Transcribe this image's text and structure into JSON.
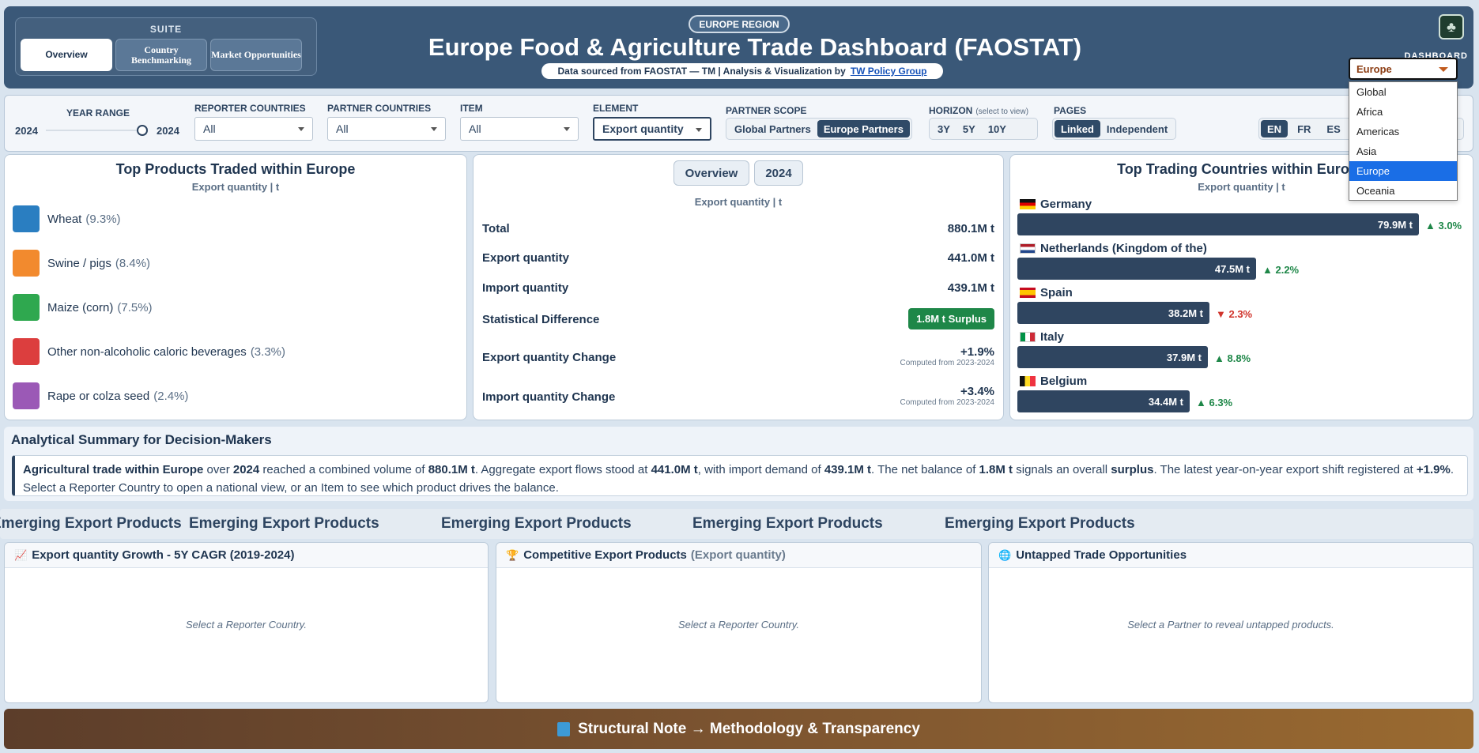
{
  "header": {
    "suite_title": "SUITE",
    "suite_tabs": [
      {
        "label": "Overview",
        "active": true
      },
      {
        "label": "Country Benchmarking",
        "active": false
      },
      {
        "label": "Market Opportunities",
        "active": false
      }
    ],
    "region_badge": "EUROPE REGION",
    "title": "Europe Food & Agriculture Trade Dashboard (FAOSTAT)",
    "subtitle_text": "Data sourced from FAOSTAT — TM | Analysis & Visualization by",
    "subtitle_link": "TW Policy Group",
    "dashboard_label": "DASHBOARD",
    "dashboard_value": "Europe",
    "dashboard_options": [
      "Global",
      "Africa",
      "Americas",
      "Asia",
      "Europe",
      "Oceania"
    ],
    "dashboard_selected_index": 4,
    "logo_icon": "leaf-logo-icon"
  },
  "filters": {
    "year_range_label": "YEAR RANGE",
    "year_start": "2024",
    "year_end": "2024",
    "reporter_label": "REPORTER COUNTRIES",
    "reporter_value": "All",
    "partner_label": "PARTNER COUNTRIES",
    "partner_value": "All",
    "item_label": "ITEM",
    "item_value": "All",
    "element_label": "ELEMENT",
    "element_value": "Export quantity",
    "scope_label": "PARTNER SCOPE",
    "scope_options": [
      "Global Partners",
      "Europe Partners"
    ],
    "scope_selected": "Europe Partners",
    "horizon_label": "HORIZON",
    "horizon_hint": "(select to view)",
    "horizon_options": [
      "3Y",
      "5Y",
      "10Y"
    ],
    "pages_label": "PAGES",
    "pages_options": [
      "Linked",
      "Independent"
    ],
    "pages_selected": "Linked",
    "languages": [
      "EN",
      "FR",
      "ES"
    ],
    "language_selected": "EN"
  },
  "top_products": {
    "title": "Top Products Traded within Europe",
    "subtitle": "Export quantity | t",
    "items": [
      {
        "name": "Wheat",
        "pct": "(9.3%)",
        "color": "#2a7ec1"
      },
      {
        "name": "Swine / pigs",
        "pct": "(8.4%)",
        "color": "#f28a2e"
      },
      {
        "name": "Maize (corn)",
        "pct": "(7.5%)",
        "color": "#2fa84f"
      },
      {
        "name": "Other non-alcoholic caloric beverages",
        "pct": "(3.3%)",
        "color": "#dc3e3e"
      },
      {
        "name": "Rape or colza seed",
        "pct": "(2.4%)",
        "color": "#9b59b6"
      }
    ]
  },
  "overview": {
    "tabs": [
      "Overview",
      "2024"
    ],
    "subtitle": "Export quantity | t",
    "rows": {
      "total_label": "Total",
      "total_value": "880.1M t",
      "export_label": "Export quantity",
      "export_value": "441.0M t",
      "import_label": "Import quantity",
      "import_value": "439.1M t",
      "diff_label": "Statistical Difference",
      "diff_value": "1.8M t Surplus",
      "export_change_label": "Export quantity Change",
      "export_change_value": "+1.9%",
      "export_change_note": "Computed from 2023-2024",
      "import_change_label": "Import quantity Change",
      "import_change_value": "+3.4%",
      "import_change_note": "Computed from 2023-2024"
    }
  },
  "top_countries": {
    "title": "Top Trading Countries within Europe",
    "subtitle": "Export quantity | t",
    "items": [
      {
        "name": "Germany",
        "value": "79.9M t",
        "change": "▲ 3.0%",
        "direction": "up",
        "share": 1.0
      },
      {
        "name": "Netherlands (Kingdom of the)",
        "value": "47.5M t",
        "change": "▲ 2.2%",
        "direction": "up",
        "share": 0.594
      },
      {
        "name": "Spain",
        "value": "38.2M t",
        "change": "▼ 2.3%",
        "direction": "down",
        "share": 0.478
      },
      {
        "name": "Italy",
        "value": "37.9M t",
        "change": "▲ 8.8%",
        "direction": "up",
        "share": 0.474
      },
      {
        "name": "Belgium",
        "value": "34.4M t",
        "change": "▲ 6.3%",
        "direction": "up",
        "share": 0.43
      }
    ]
  },
  "summary": {
    "title": "Analytical Summary for Decision-Makers",
    "p1": "Agricultural trade within Europe",
    "p2": " over ",
    "p3": "2024",
    "p4": " reached a combined volume of ",
    "p5": "880.1M t",
    "p6": ". Aggregate export flows stood at ",
    "p7": "441.0M t",
    "p8": ", with import demand of ",
    "p9": "439.1M t",
    "p10": ". The net balance of ",
    "p11": "1.8M t",
    "p12": " signals an overall ",
    "p13": "surplus",
    "p14": ". The latest year-on-year export shift registered at ",
    "p15": "+1.9%",
    "p16": ". Select a Reporter Country to open a national view, or an Item to see which product drives the balance."
  },
  "ticker": {
    "items": [
      "Emerging Export Products",
      "Emerging Export Products",
      "Emerging Export Products",
      "Emerging Export Products",
      "Emerging Export Products"
    ]
  },
  "bottom_panels": [
    {
      "title": "Export quantity Growth - 5Y CAGR (2019-2024)",
      "suffix": "",
      "empty": "Select a Reporter Country.",
      "icon": "chart-icon"
    },
    {
      "title": "Competitive Export Products",
      "suffix": "(Export quantity)",
      "empty": "Select a Reporter Country.",
      "icon": "trophy-icon"
    },
    {
      "title": "Untapped Trade Opportunities",
      "suffix": "",
      "empty": "Select a Partner to reveal untapped products.",
      "icon": "globe-icon"
    }
  ],
  "footer": {
    "label": "Structural Note → Methodology & Transparency",
    "icon": "book-icon"
  }
}
